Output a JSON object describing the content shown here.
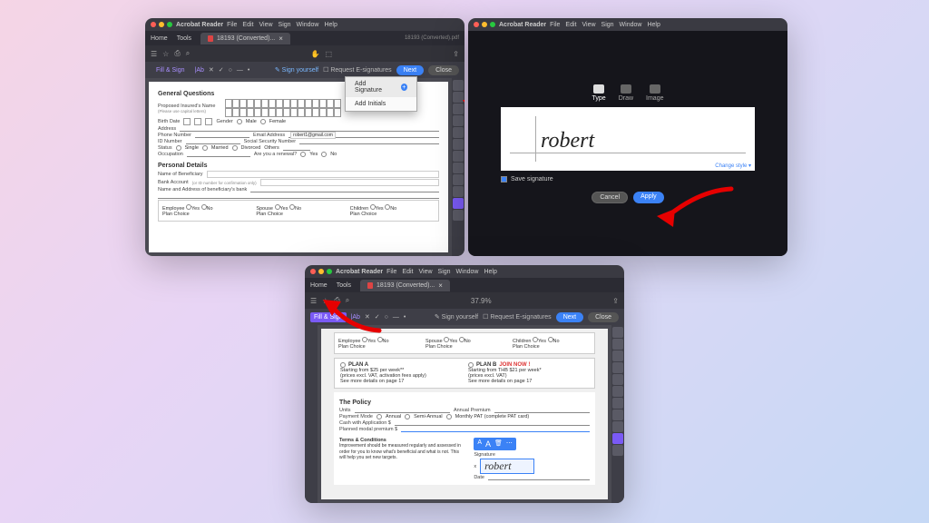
{
  "app": {
    "name": "Acrobat Reader",
    "menus": [
      "File",
      "Edit",
      "View",
      "Sign",
      "Window",
      "Help"
    ]
  },
  "doc": {
    "tab_name": "18193 (Converted)...",
    "filename": "18193 (Converted).pdf",
    "nav_home": "Home",
    "nav_tools": "Tools"
  },
  "fillsign": {
    "title": "Fill & Sign",
    "sign_yourself": "Sign yourself",
    "request": "Request E-signatures",
    "next": "Next",
    "close": "Close"
  },
  "dropdown": {
    "add_signature": "Add Signature",
    "add_initials": "Add Initials"
  },
  "form": {
    "section1": "General Questions",
    "name_label": "Proposed Insured's Name",
    "name_hint": "(Please use capital letters)",
    "birth": "Birth Date",
    "gender": "Gender",
    "male": "Male",
    "female": "Female",
    "address": "Address",
    "phone": "Phone Number",
    "email_label": "Email Address",
    "email_value": "robert1@gmail.com",
    "id": "ID Number",
    "ssn": "Social Security Number",
    "status": "Status",
    "single": "Single",
    "married": "Married",
    "divorced": "Divorced",
    "others": "Others",
    "occupation": "Occupation",
    "renewal": "Are you a renewal?",
    "yes": "Yes",
    "no": "No",
    "section2": "Personal Details",
    "beneficiary": "Name of Beneficiary",
    "bank": "Bank Account",
    "bank_hint": "(or ID number for confirmation only)",
    "bene_addr": "Name and Address of beneficiary's bank",
    "employee": "Employee",
    "spouse": "Spouse",
    "children": "Children",
    "plan_choice": "Plan Choice"
  },
  "sigmodal": {
    "tab_type": "Type",
    "tab_draw": "Draw",
    "tab_image": "Image",
    "signature": "robert",
    "change_style": "Change style",
    "save": "Save signature",
    "cancel": "Cancel",
    "apply": "Apply"
  },
  "form3": {
    "plan_a": "PLAN A",
    "plan_a_price": "Starting from $25 per week**",
    "plan_a_note1": "(prices excl. VAT, activation fees apply)",
    "plan_a_note2": "See more details on page 17",
    "plan_b": "PLAN B",
    "join": "JOIN NOW !",
    "plan_b_price": "Starting from THB $21 per week*",
    "plan_b_note1": "(prices excl. VAT)",
    "plan_b_note2": "See more details on page 17",
    "policy": "The Policy",
    "units": "Units",
    "premium": "Annual Premium",
    "payment": "Payment Mode",
    "annual": "Annual",
    "semi": "Semi-Annual",
    "monthly": "Monthly PAT (complete PAT card)",
    "cash": "Cash with Application   $",
    "planned": "Planned modal premium   $",
    "terms_head": "Terms & Conditions",
    "terms_body": "Improvement should be measured regularly and assessed in order for you to know what's beneficial and what is not. This will help you set new targets.",
    "sig_label": "Signature",
    "date_label": "Date",
    "x": "x",
    "sig_value": "robert",
    "zoom": "37.9%"
  }
}
